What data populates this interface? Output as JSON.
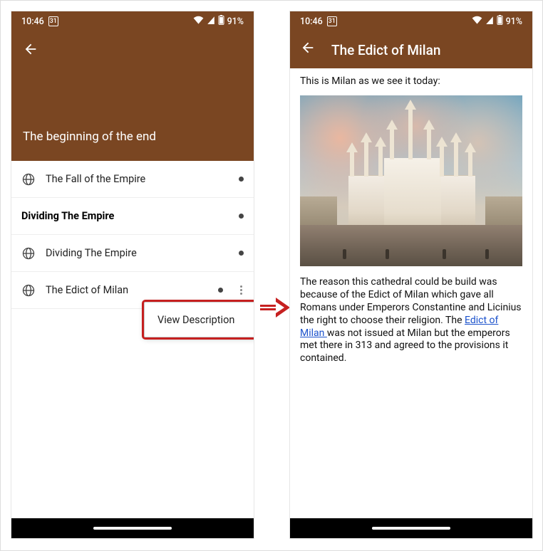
{
  "status": {
    "time": "10:46",
    "calendar_day": "31",
    "battery": "91%"
  },
  "left": {
    "header_title": "The beginning of the end",
    "section_header": "Dividing The Empire",
    "rows": [
      {
        "label": "The Fall of the Empire"
      },
      {
        "label": "Dividing The Empire"
      },
      {
        "label": "The Edict of Milan"
      }
    ],
    "popup": {
      "item": "View Description"
    }
  },
  "right": {
    "title": "The Edict of Milan",
    "intro": "This is Milan as we see it today:",
    "body_before_link": "The reason this cathedral could be build was because of the Edict of Milan which gave all Romans under Emperors Constantine and Licinius the right to choose their religion. The ",
    "link_text": "Edict of Milan ",
    "body_after_link": "was not issued at Milan but the emperors met there in 313 and agreed to the provisions it contained."
  }
}
